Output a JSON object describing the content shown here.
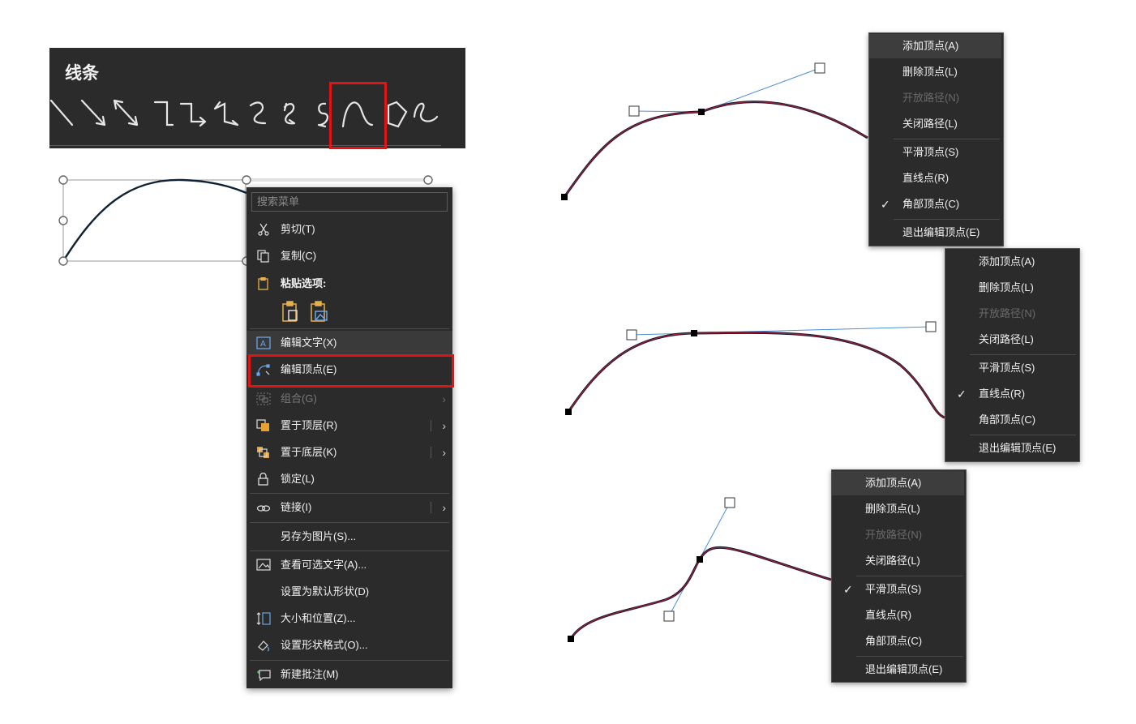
{
  "lines_panel": {
    "title": "线条"
  },
  "search": {
    "placeholder": "搜索菜单"
  },
  "context_menu": {
    "cut": "剪切(T)",
    "copy": "复制(C)",
    "paste_options": "粘贴选项:",
    "edit_text": "编辑文字(X)",
    "edit_vertices": "编辑顶点(E)",
    "group": "组合(G)",
    "bring_to_front": "置于顶层(R)",
    "send_to_back": "置于底层(K)",
    "lock": "锁定(L)",
    "link": "链接(I)",
    "save_as_picture": "另存为图片(S)...",
    "view_alt_text": "查看可选文字(A)...",
    "set_default_shape": "设置为默认形状(D)",
    "size_position": "大小和位置(Z)...",
    "format_shape": "设置形状格式(O)...",
    "new_comment": "新建批注(M)"
  },
  "vertex_menu": {
    "items": [
      {
        "label": "添加顶点(A)"
      },
      {
        "label": "删除顶点(L)"
      },
      {
        "label": "开放路径(N)"
      },
      {
        "label": "关闭路径(L)"
      },
      {
        "label": "平滑顶点(S)"
      },
      {
        "label": "直线点(R)"
      },
      {
        "label": "角部顶点(C)"
      },
      {
        "label": "退出编辑顶点(E)"
      }
    ],
    "checked": [
      "角部顶点(C)",
      "直线点(R)",
      "平滑顶点(S)"
    ]
  },
  "colors": {
    "menu_bg": "#2b2b2b",
    "highlight_red": "#e01414",
    "curve": "#1a1a2e",
    "handle_line": "#4a90d9"
  }
}
